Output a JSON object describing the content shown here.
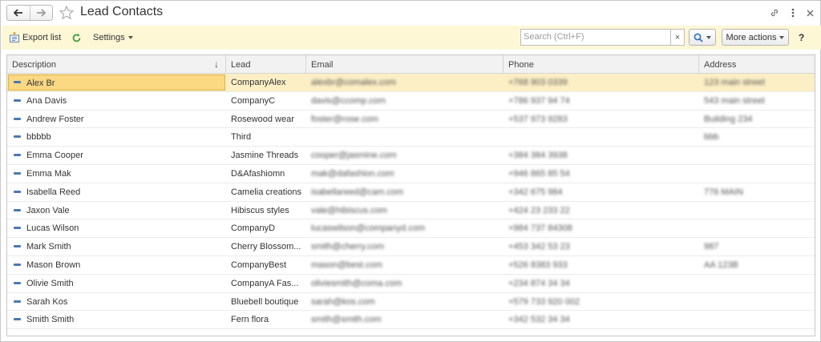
{
  "window": {
    "title": "Lead Contacts"
  },
  "toolbar": {
    "export_label": "Export list",
    "settings_label": "Settings",
    "search_placeholder": "Search (Ctrl+F)",
    "clear_label": "×",
    "more_actions_label": "More actions",
    "help_label": "?"
  },
  "table": {
    "columns": [
      "Description",
      "Lead",
      "Email",
      "Phone",
      "Address"
    ],
    "rows": [
      {
        "description": "Alex Br",
        "lead": "CompanyAlex",
        "email": "alexbr@comalex.com",
        "phone": "+768 903 0339",
        "address": "123 main street"
      },
      {
        "description": "Ana Davis",
        "lead": "CompanyC",
        "email": "davis@ccomp.com",
        "phone": "+786 937 94 74",
        "address": "543 main street"
      },
      {
        "description": "Andrew Foster",
        "lead": "Rosewood wear",
        "email": "foster@rose.com",
        "phone": "+537 973 9283",
        "address": "Building 234"
      },
      {
        "description": "bbbbb",
        "lead": "Third",
        "email": "",
        "phone": "",
        "address": "bbb"
      },
      {
        "description": "Emma Cooper",
        "lead": "Jasmine Threads",
        "email": "cooper@jasmine.com",
        "phone": "+384 384 3938",
        "address": ""
      },
      {
        "description": "Emma Mak",
        "lead": "D&Afashiomn",
        "email": "mak@dafashion.com",
        "phone": "+946 865 85 54",
        "address": ""
      },
      {
        "description": "Isabella Reed",
        "lead": "Camelia creations",
        "email": "isabellareed@cam.com",
        "phone": "+342 675 984",
        "address": "776 MAIN"
      },
      {
        "description": "Jaxon Vale",
        "lead": "Hibiscus styles",
        "email": "vale@hibiscus.com",
        "phone": "+424 23 233 22",
        "address": ""
      },
      {
        "description": "Lucas Wilson",
        "lead": "CompanyD",
        "email": "lucaswilson@companyd.com",
        "phone": "+984 737 84308",
        "address": ""
      },
      {
        "description": "Mark Smith",
        "lead": "Cherry Blossom...",
        "email": "smith@cherry.com",
        "phone": "+453 342 53 23",
        "address": "987"
      },
      {
        "description": "Mason Brown",
        "lead": "CompanyBest",
        "email": "mason@best.com",
        "phone": "+526 8383 933",
        "address": "AA 123B"
      },
      {
        "description": "Olivie Smith",
        "lead": "CompanyA Fas...",
        "email": "oliviesmith@coma.com",
        "phone": "+234 874 34 34",
        "address": ""
      },
      {
        "description": "Sarah Kos",
        "lead": "Bluebell boutique",
        "email": "sarah@kos.com",
        "phone": "+579 733 920 002",
        "address": ""
      },
      {
        "description": "Smith Smith",
        "lead": "Fern flora",
        "email": "smith@smith.com",
        "phone": "+342 532 34 34",
        "address": ""
      }
    ]
  },
  "colors": {
    "command_bar_bg": "#fdf7d6",
    "selected_row_bg": "#fcefc5",
    "selected_cell_bg": "#fbd983",
    "row_icon": "#4a78b5",
    "refresh_icon": "#3a9b3a",
    "search_icon": "#2a6fc0"
  },
  "icons": [
    "back-arrow-icon",
    "forward-arrow-icon",
    "favorite-star-icon",
    "link-icon",
    "more-vertical-icon",
    "export-list-icon",
    "refresh-icon",
    "search-icon",
    "row-item-icon"
  ]
}
